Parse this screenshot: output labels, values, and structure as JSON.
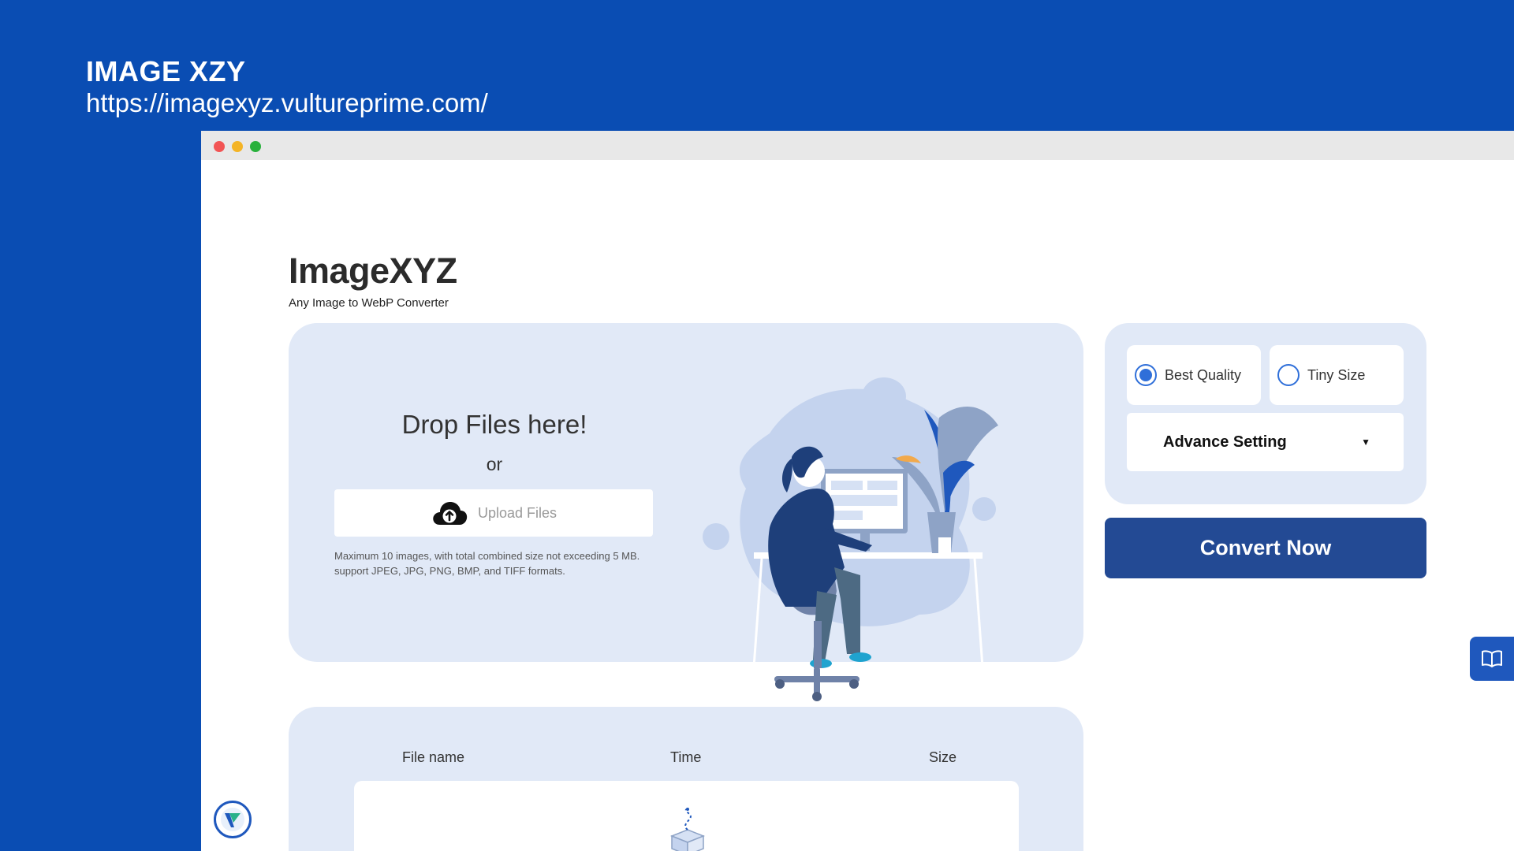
{
  "header": {
    "title": "IMAGE XZY",
    "url": "https://imagexyz.vultureprime.com/"
  },
  "app": {
    "name": "ImageXYZ",
    "subtitle": "Any Image to WebP Converter"
  },
  "dropzone": {
    "title": "Drop Files here!",
    "or": "or",
    "upload_label": "Upload Files",
    "note_line1": "Maximum 10 images, with total combined size not exceeding 5 MB.",
    "note_line2": "support JPEG, JPG, PNG, BMP, and TIFF formats.",
    "upload_icon": "cloud-upload-icon"
  },
  "options": {
    "quality": [
      {
        "label": "Best Quality",
        "selected": true
      },
      {
        "label": "Tiny Size",
        "selected": false
      }
    ],
    "advance_label": "Advance Setting",
    "advance_icon": "caret-down-icon"
  },
  "convert_label": "Convert Now",
  "file_list": {
    "columns": [
      "File name",
      "Time",
      "Size"
    ]
  },
  "side_buttons": {
    "book_icon": "book-icon",
    "badge_icon": "vulture-logo-icon"
  },
  "colors": {
    "background": "#0a4db3",
    "panel": "#e1e9f7",
    "convert": "#234a94",
    "radio": "#2f6fd9"
  }
}
